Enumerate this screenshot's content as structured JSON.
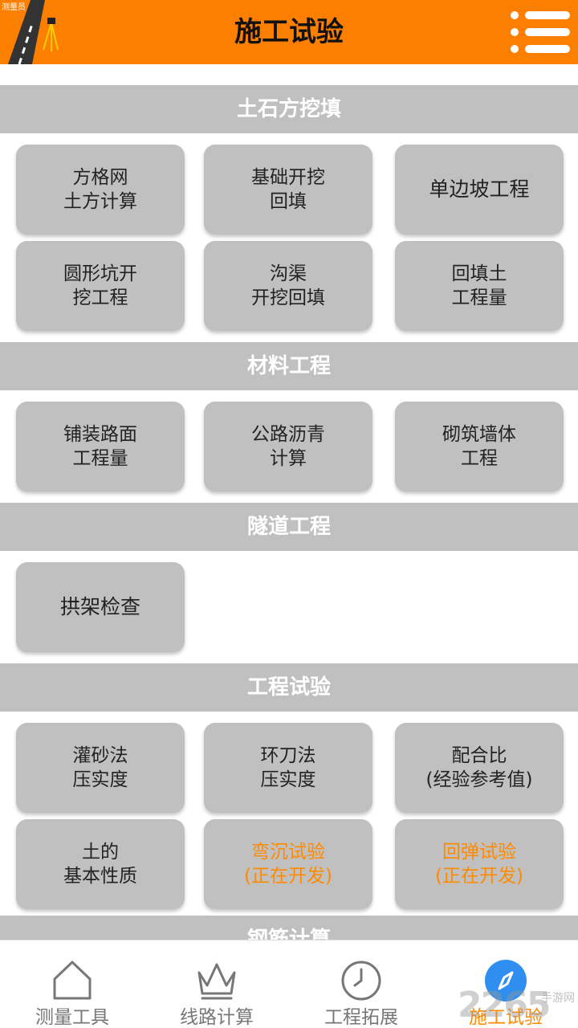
{
  "header": {
    "title": "施工试验",
    "logo_text": "测量员"
  },
  "sections": [
    {
      "title": "土石方挖填",
      "tiles": [
        {
          "lines": [
            "方格网",
            "土方计算"
          ]
        },
        {
          "lines": [
            "基础开挖",
            "回填"
          ]
        },
        {
          "lines": [
            "单边坡工程"
          ]
        },
        {
          "lines": [
            "圆形坑开",
            "挖工程"
          ]
        },
        {
          "lines": [
            "沟渠",
            "开挖回填"
          ]
        },
        {
          "lines": [
            "回填土",
            "工程量"
          ]
        }
      ]
    },
    {
      "title": "材料工程",
      "tiles": [
        {
          "lines": [
            "铺装路面",
            "工程量"
          ]
        },
        {
          "lines": [
            "公路沥青",
            "计算"
          ]
        },
        {
          "lines": [
            "砌筑墙体",
            "工程"
          ]
        }
      ]
    },
    {
      "title": "隧道工程",
      "tiles": [
        {
          "lines": [
            "拱架检查"
          ]
        }
      ]
    },
    {
      "title": "工程试验",
      "tiles": [
        {
          "lines": [
            "灌砂法",
            "压实度"
          ]
        },
        {
          "lines": [
            "环刀法",
            "压实度"
          ]
        },
        {
          "lines": [
            "配合比",
            "(经验参考值)"
          ]
        },
        {
          "lines": [
            "土的",
            "基本性质"
          ]
        },
        {
          "lines": [
            "弯沉试验",
            "(正在开发)"
          ],
          "in_development": true
        },
        {
          "lines": [
            "回弹试验",
            "(正在开发)"
          ],
          "in_development": true
        }
      ]
    },
    {
      "title": "钢筋计算",
      "tiles": []
    }
  ],
  "bottom_nav": [
    {
      "label": "测量工具",
      "icon": "home-icon"
    },
    {
      "label": "线路计算",
      "icon": "crown-icon"
    },
    {
      "label": "工程拓展",
      "icon": "clock-icon"
    },
    {
      "label": "施工试验",
      "icon": "compass-icon",
      "active": true
    }
  ],
  "watermark": {
    "brand": "2265",
    "suffix": "手游网"
  },
  "colors": {
    "header_bg": "#fd7f00",
    "section_bg": "#c0c0c0",
    "tile_bg": "#c0c0c0",
    "accent": "#ff8a00",
    "active_nav": "#2f8ff0"
  }
}
